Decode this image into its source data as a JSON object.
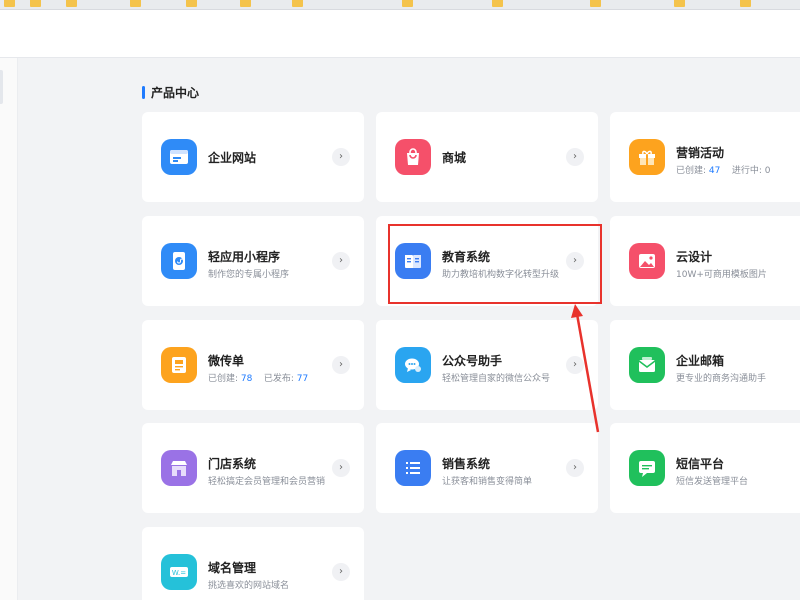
{
  "section": {
    "title": "产品中心"
  },
  "cards": [
    {
      "title": "企业网站",
      "desc": "",
      "icon": "website-icon",
      "color": "#2f8bf7"
    },
    {
      "title": "商城",
      "desc": "",
      "icon": "shopping-bag-icon",
      "color": "#f5506a"
    },
    {
      "title": "营销活动",
      "icon": "gift-icon",
      "color": "#fda31e",
      "stats": [
        {
          "label": "已创建:",
          "value": "47"
        },
        {
          "label": "进行中:",
          "value": "0"
        }
      ]
    },
    {
      "title": "轻应用小程序",
      "desc": "制作您的专属小程序",
      "icon": "mini-program-icon",
      "color": "#2f8bf7"
    },
    {
      "title": "教育系统",
      "desc": "助力教培机构数字化转型升级",
      "icon": "book-icon",
      "color": "#3a7df2"
    },
    {
      "title": "云设计",
      "desc": "10W+可商用模板图片",
      "icon": "image-icon",
      "color": "#f5506a"
    },
    {
      "title": "微传单",
      "icon": "flyer-icon",
      "color": "#fda31e",
      "stats": [
        {
          "label": "已创建:",
          "value": "78"
        },
        {
          "label": "已发布:",
          "value": "77"
        }
      ]
    },
    {
      "title": "公众号助手",
      "desc": "轻松管理自家的微信公众号",
      "icon": "wechat-icon",
      "color": "#2aa5f0"
    },
    {
      "title": "企业邮箱",
      "desc": "更专业的商务沟通助手",
      "icon": "mail-icon",
      "color": "#20c05c"
    },
    {
      "title": "门店系统",
      "desc": "轻松搞定会员管理和会员营销",
      "icon": "store-icon",
      "color": "#9a72e6"
    },
    {
      "title": "销售系统",
      "desc": "让获客和销售变得简单",
      "icon": "list-icon",
      "color": "#3a7df2"
    },
    {
      "title": "短信平台",
      "desc": "短信发送管理平台",
      "icon": "sms-icon",
      "color": "#20c05c"
    },
    {
      "title": "域名管理",
      "desc": "挑选喜欢的网站域名",
      "icon": "domain-icon",
      "color": "#25c1d9"
    }
  ],
  "arrow_glyph": "›",
  "colors": {
    "accent": "#1f7bff",
    "highlight": "#e8322c"
  }
}
